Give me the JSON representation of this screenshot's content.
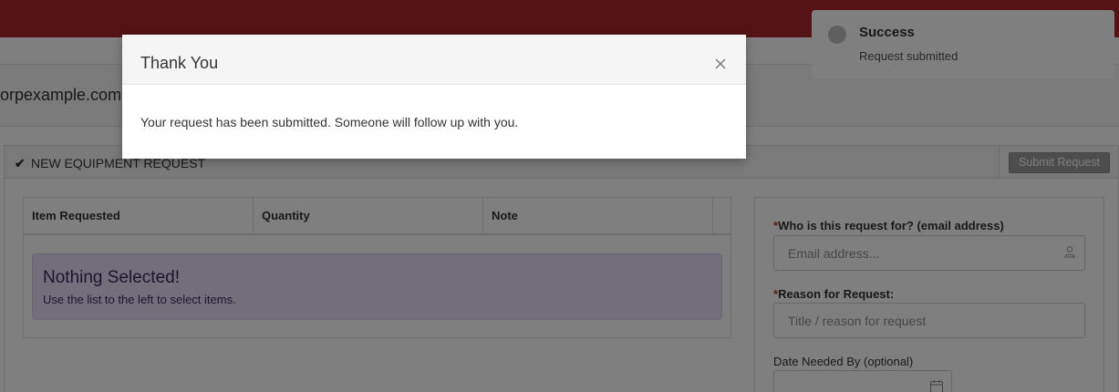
{
  "page": {
    "domain_text": "orpexample.com"
  },
  "panel": {
    "title": "NEW EQUIPMENT REQUEST",
    "submit_label": "Submit Request"
  },
  "table": {
    "columns": [
      "Item Requested",
      "Quantity",
      "Note"
    ],
    "empty_title": "Nothing Selected!",
    "empty_text": "Use the list to the left to select items."
  },
  "form": {
    "required_marker": "*",
    "email_label": "Who is this request for? (email address)",
    "email_placeholder": "Email address...",
    "reason_label": "Reason for Request:",
    "reason_placeholder": "Title / reason for request",
    "date_label": "Date Needed By (optional)"
  },
  "toast": {
    "title": "Success",
    "text": "Request submitted"
  },
  "modal": {
    "title": "Thank You",
    "body": "Your request has been submitted. Someone will follow up with you."
  },
  "colors": {
    "topbar": "#a8252b",
    "alert_bg": "#e5def6",
    "required": "#c0392b",
    "button": "#9b9b9b"
  },
  "icons": {
    "check": "check-icon",
    "close": "close-icon",
    "person": "person-icon",
    "calendar": "calendar-icon"
  }
}
